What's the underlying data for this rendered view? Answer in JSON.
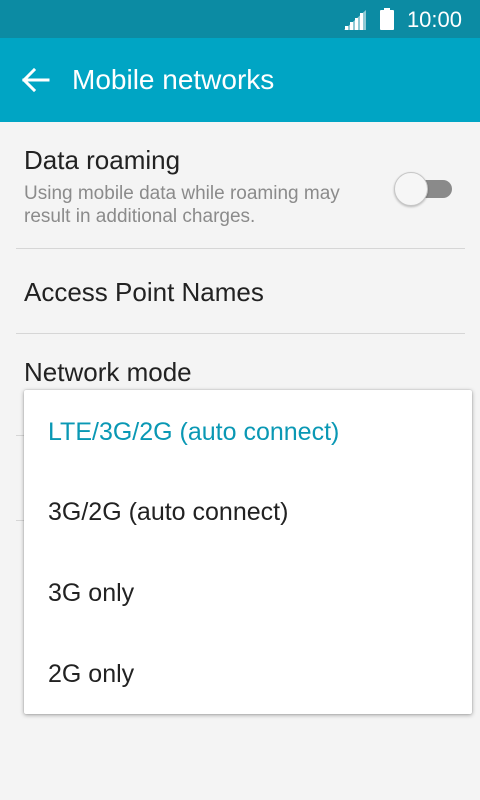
{
  "status_bar": {
    "time": "10:00",
    "signal_icon": "signal-icon",
    "battery_icon": "battery-icon"
  },
  "app_bar": {
    "title": "Mobile networks",
    "back_icon": "arrow-left-icon"
  },
  "settings": {
    "data_roaming": {
      "title": "Data roaming",
      "summary": "Using mobile data while roaming may result in additional charges.",
      "enabled": false
    },
    "access_point_names": {
      "title": "Access Point Names"
    },
    "network_mode": {
      "title": "Network mode"
    }
  },
  "network_mode_popup": {
    "options": [
      {
        "label": "LTE/3G/2G (auto connect)",
        "selected": true
      },
      {
        "label": "3G/2G (auto connect)",
        "selected": false
      },
      {
        "label": "3G only",
        "selected": false
      },
      {
        "label": "2G only",
        "selected": false
      }
    ]
  },
  "colors": {
    "status_bar": "#0c8ba3",
    "app_bar": "#00a5c4",
    "accent": "#0a98b4",
    "background": "#f4f4f4"
  }
}
